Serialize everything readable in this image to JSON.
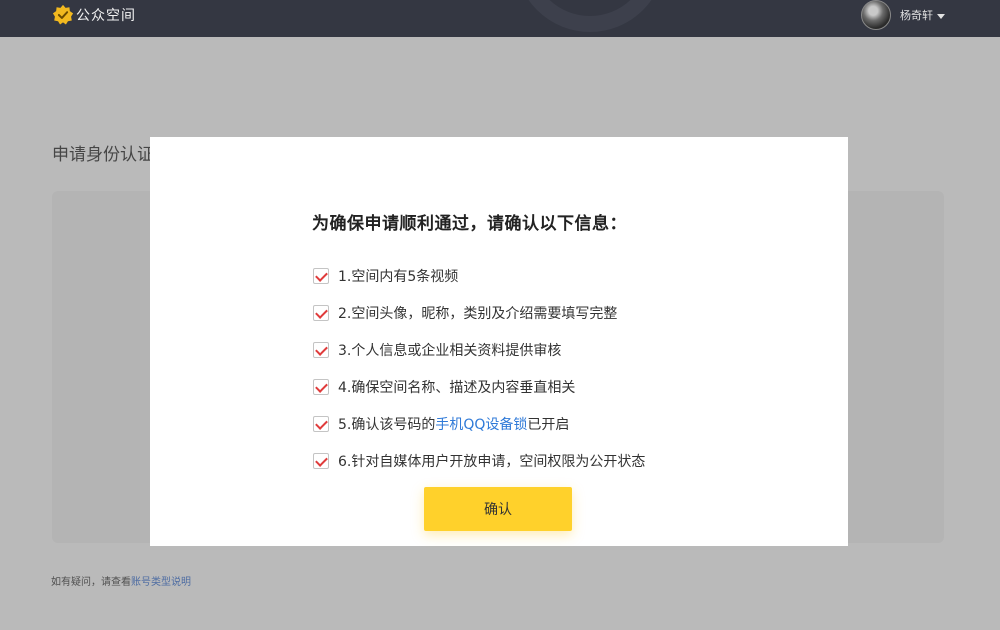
{
  "header": {
    "app_name": "公众空间",
    "logo_icon": "badge-check-icon",
    "username": "杨奇轩",
    "menu_icon": "caret-down-icon"
  },
  "page": {
    "title": "申请身份认证",
    "help_prefix": "如有疑问，请查看",
    "help_link": "账号类型说明"
  },
  "modal": {
    "title": "为确保申请顺利通过，请确认以下信息：",
    "items": [
      {
        "text": "1.空间内有5条视频",
        "checked": true
      },
      {
        "text": "2.空间头像，昵称，类别及介绍需要填写完整",
        "checked": true
      },
      {
        "text": "3.个人信息或企业相关资料提供审核",
        "checked": true
      },
      {
        "text": "4.确保空间名称、描述及内容垂直相关",
        "checked": true
      },
      {
        "text_before": "5.确认该号码的",
        "link": "手机QQ设备锁",
        "text_after": "已开启",
        "checked": true
      },
      {
        "text": "6.针对自媒体用户开放申请，空间权限为公开状态",
        "checked": true
      }
    ],
    "confirm_label": "确认"
  },
  "colors": {
    "topbar": "#343742",
    "brand_yellow": "#ffd12b",
    "check_red": "#e03b3b",
    "link_blue": "#2f7ad8"
  }
}
